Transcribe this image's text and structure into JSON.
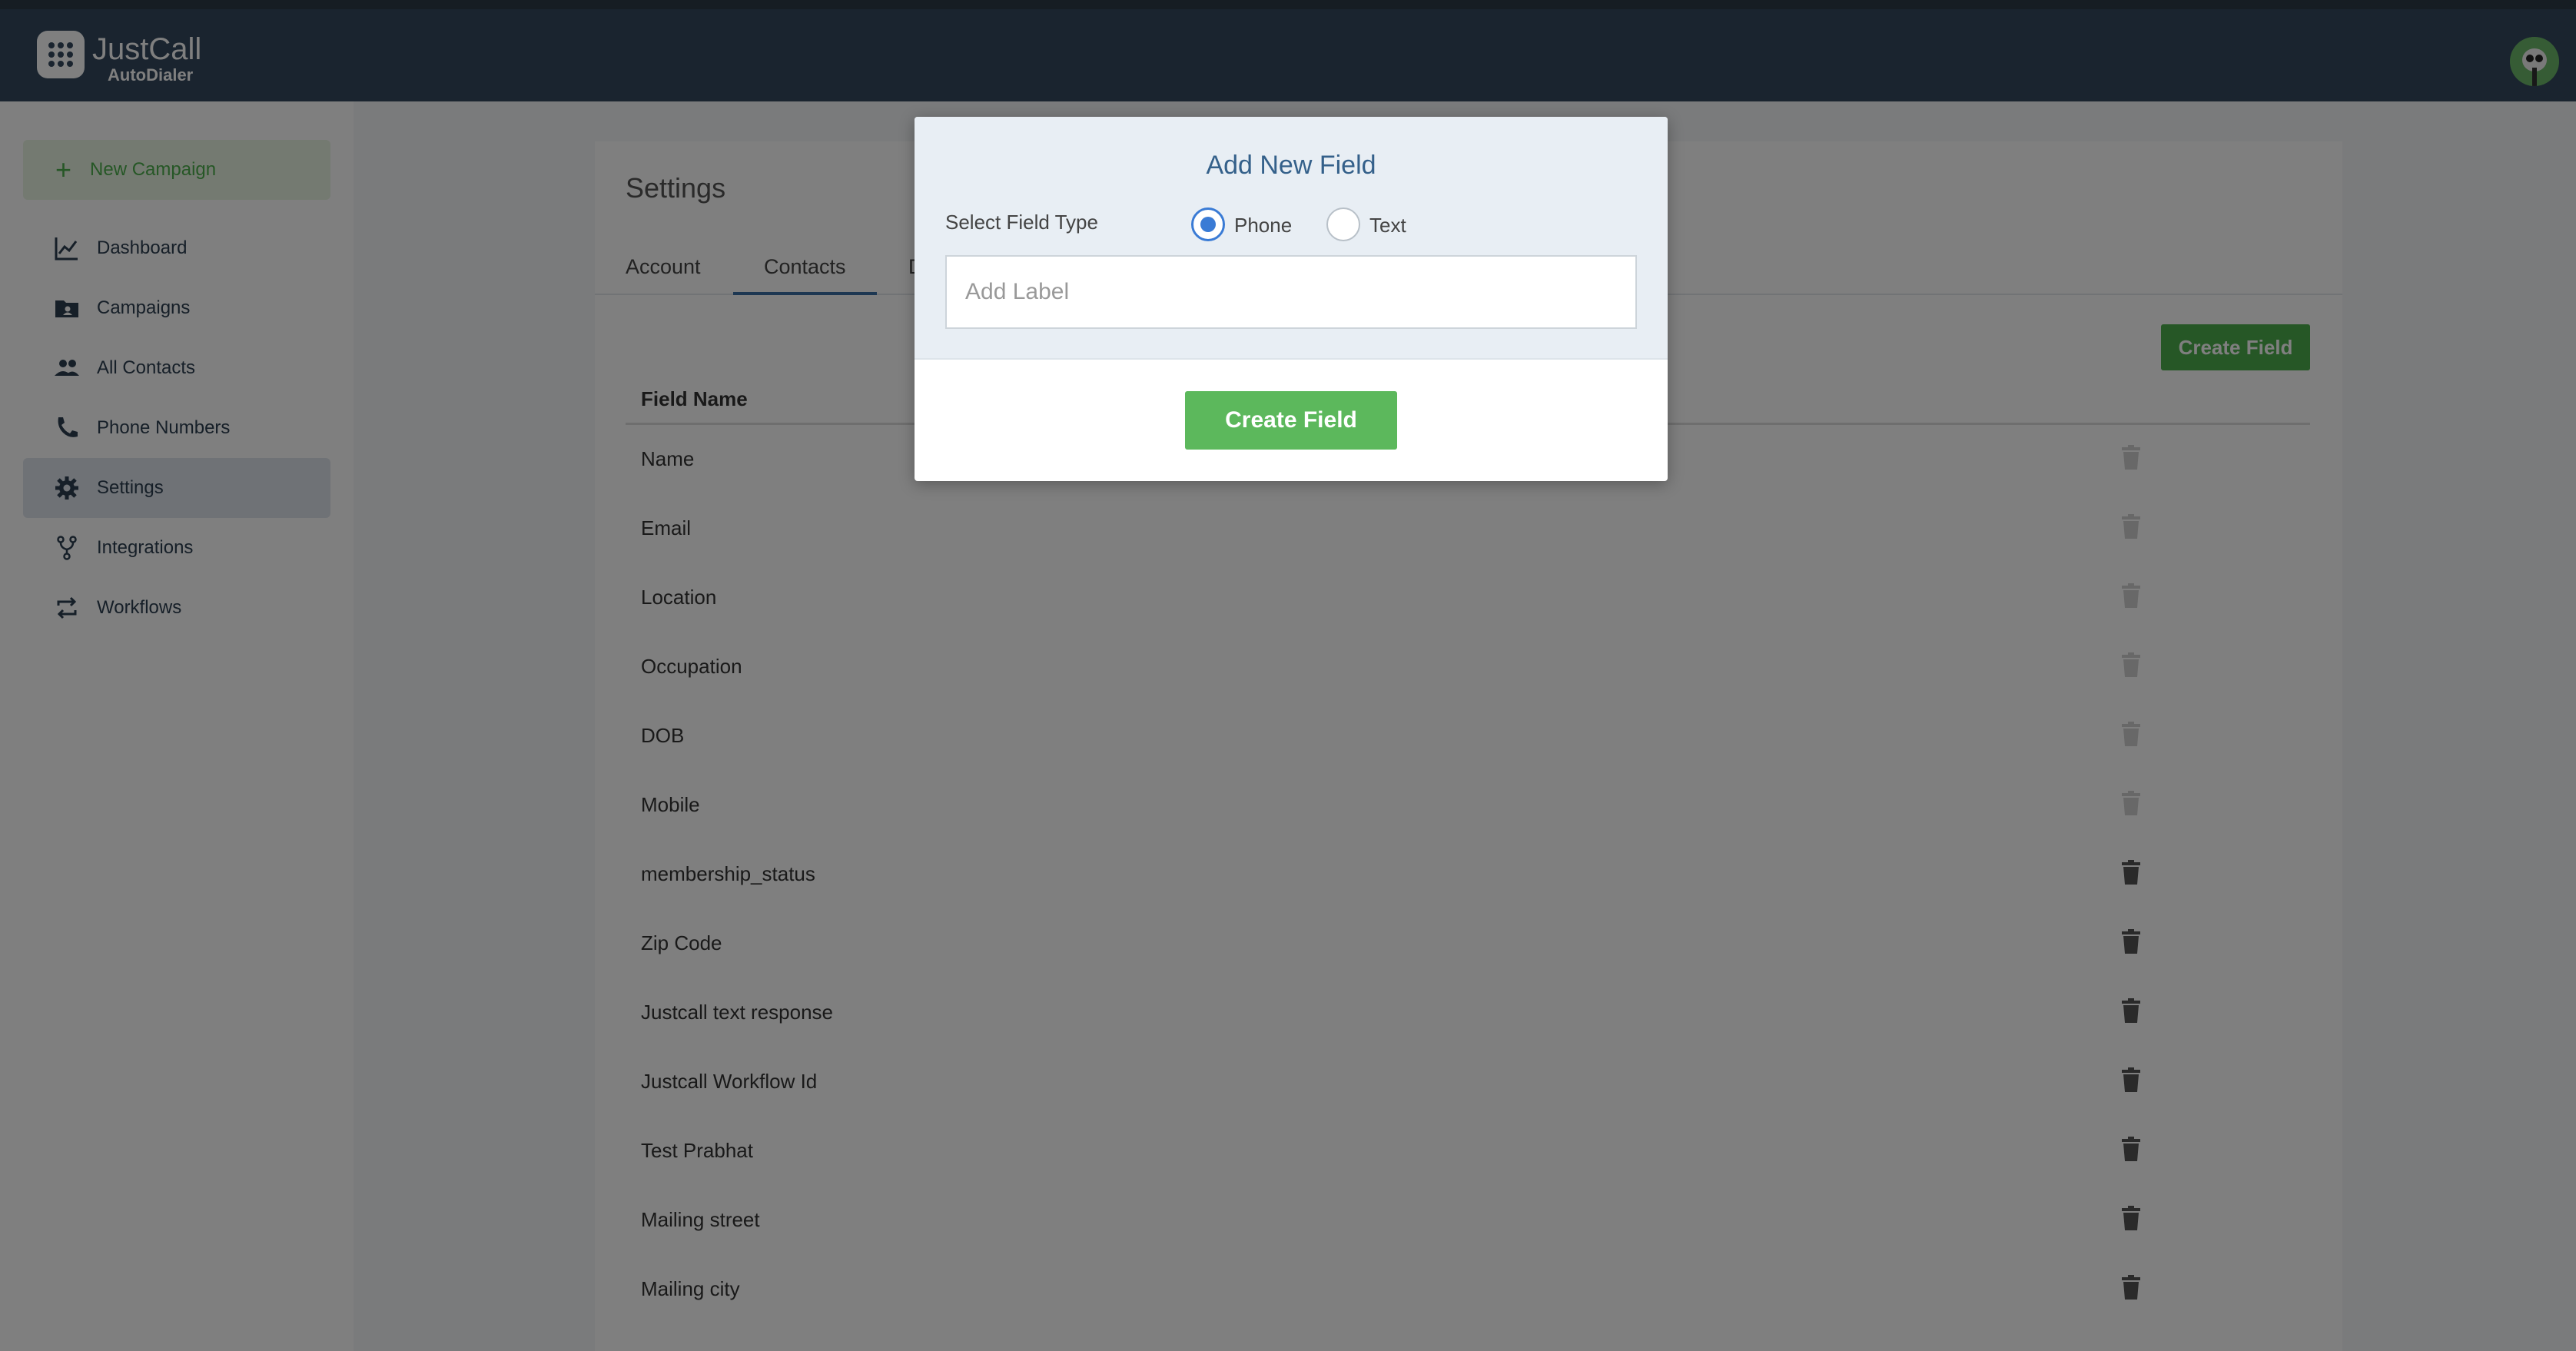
{
  "app": {
    "brand_name": "JustCall",
    "brand_sub": "AutoDialer"
  },
  "sidebar": {
    "new_campaign": "New Campaign",
    "items": [
      {
        "label": "Dashboard",
        "icon": "chart-line-icon"
      },
      {
        "label": "Campaigns",
        "icon": "folder-user-icon"
      },
      {
        "label": "All Contacts",
        "icon": "users-icon"
      },
      {
        "label": "Phone Numbers",
        "icon": "phone-icon"
      },
      {
        "label": "Settings",
        "icon": "gear-icon",
        "active": true
      },
      {
        "label": "Integrations",
        "icon": "fork-icon"
      },
      {
        "label": "Workflows",
        "icon": "repeat-icon"
      }
    ]
  },
  "settings": {
    "title": "Settings",
    "tabs": [
      "Account",
      "Contacts",
      "D"
    ],
    "create_field_label": "Create Field",
    "table": {
      "header": "Field Name",
      "rows": [
        {
          "name": "Name",
          "deletable": false
        },
        {
          "name": "Email",
          "deletable": false
        },
        {
          "name": "Location",
          "deletable": false
        },
        {
          "name": "Occupation",
          "deletable": false
        },
        {
          "name": "DOB",
          "deletable": false
        },
        {
          "name": "Mobile",
          "deletable": false
        },
        {
          "name": "membership_status",
          "deletable": true
        },
        {
          "name": "Zip Code",
          "deletable": true
        },
        {
          "name": "Justcall text response",
          "deletable": true
        },
        {
          "name": "Justcall Workflow Id",
          "deletable": true
        },
        {
          "name": "Test Prabhat",
          "deletable": true
        },
        {
          "name": "Mailing street",
          "deletable": true
        },
        {
          "name": "Mailing city",
          "deletable": true
        }
      ]
    }
  },
  "modal": {
    "title": "Add New Field",
    "field_type_label": "Select Field Type",
    "options": [
      "Phone",
      "Text"
    ],
    "selected_option": "Phone",
    "label_placeholder": "Add Label",
    "submit_label": "Create Field"
  },
  "colors": {
    "header_bg": "#34495e",
    "accent_green": "#5cb85c",
    "radio_blue": "#3a7bd5",
    "active_tab": "#3a6ea5"
  }
}
